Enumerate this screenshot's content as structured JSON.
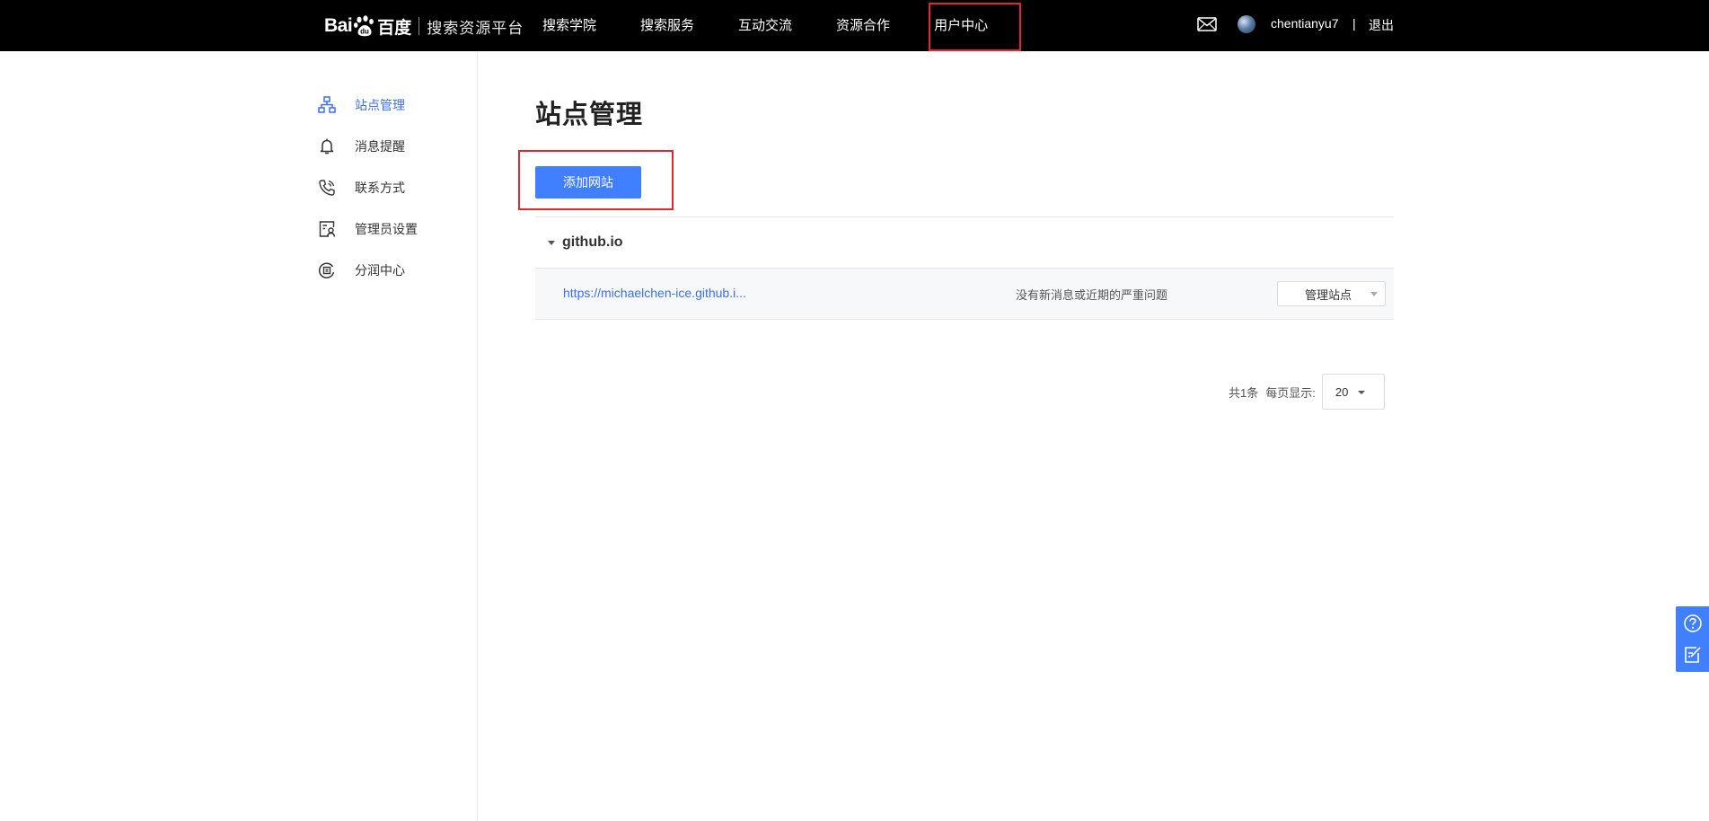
{
  "header": {
    "logo": {
      "bai": "Bai",
      "du": "百度",
      "platform": "搜索资源平台"
    },
    "nav": [
      {
        "label": "搜索学院"
      },
      {
        "label": "搜索服务"
      },
      {
        "label": "互动交流"
      },
      {
        "label": "资源合作"
      },
      {
        "label": "用户中心",
        "active": true
      }
    ],
    "mail_icon": "mail-icon",
    "username": "chentianyu7",
    "separator": "|",
    "logout": "退出"
  },
  "sidebar": {
    "items": [
      {
        "label": "站点管理",
        "icon": "sitemap-icon",
        "active": true
      },
      {
        "label": "消息提醒",
        "icon": "bell-icon"
      },
      {
        "label": "联系方式",
        "icon": "phone-icon"
      },
      {
        "label": "管理员设置",
        "icon": "admin-user-icon"
      },
      {
        "label": "分润中心",
        "icon": "revenue-icon"
      }
    ]
  },
  "main": {
    "title": "站点管理",
    "add_button": "添加网站",
    "group": {
      "name": "github.io",
      "sites": [
        {
          "url": "https://michaelchen-ice.github.i...",
          "status": "没有新消息或近期的严重问题",
          "action": "管理站点"
        }
      ]
    },
    "pagination": {
      "total": "共1条",
      "per_page_label": "每页显示:",
      "per_page_value": "20"
    }
  },
  "colors": {
    "accent": "#4080ff",
    "link": "#3a6ff6",
    "highlight_frame": "#e5262e",
    "topbar": "#000000"
  },
  "float_bar": {
    "icons": [
      "help-icon",
      "feedback-edit-icon"
    ]
  }
}
